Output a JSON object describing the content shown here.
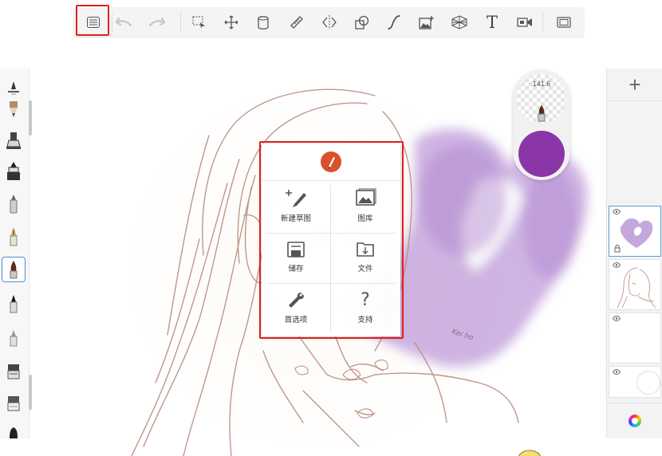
{
  "toolbar": {
    "buttons": [
      {
        "name": "menu-list-icon",
        "state": "highlighted"
      },
      {
        "name": "undo-icon",
        "state": "disabled"
      },
      {
        "name": "redo-icon",
        "state": "disabled"
      },
      {
        "name": "selection-icon"
      },
      {
        "name": "transform-icon"
      },
      {
        "name": "fill-icon"
      },
      {
        "name": "ruler-icon"
      },
      {
        "name": "symmetry-icon"
      },
      {
        "name": "shape-icon"
      },
      {
        "name": "stroke-curve-icon"
      },
      {
        "name": "add-image-icon"
      },
      {
        "name": "perspective-icon"
      },
      {
        "name": "text-icon",
        "glyph": "T"
      },
      {
        "name": "timelapse-icon"
      },
      {
        "name": "fullscreen-icon"
      }
    ]
  },
  "brushes": {
    "selected_index": 5,
    "items": [
      "brush-opacity-slider-icon",
      "pencil-brush-icon",
      "marker-brush-icon",
      "ink-pen-brush-icon",
      "ballpoint-brush-icon",
      "fountain-pen-brush-icon",
      "paint-brush-icon",
      "felt-tip-brush-icon",
      "airbrush-icon",
      "eraser-brush-icon",
      "soft-eraser-brush-icon",
      "smudge-brush-icon"
    ]
  },
  "puck": {
    "size_value": "141.6",
    "color": "#8a35a8"
  },
  "menu": {
    "items": [
      {
        "name": "new-sketch",
        "label": "新建草图",
        "icon": "new-sketch-icon"
      },
      {
        "name": "gallery",
        "label": "图库",
        "icon": "gallery-icon"
      },
      {
        "name": "save",
        "label": "储存",
        "icon": "save-icon"
      },
      {
        "name": "file",
        "label": "文件",
        "icon": "file-icon"
      },
      {
        "name": "preferences",
        "label": "首选项",
        "icon": "wrench-icon"
      },
      {
        "name": "support",
        "label": "支持",
        "icon": "question-icon",
        "glyph": "?"
      }
    ]
  },
  "layers": {
    "add_label": "+",
    "items": [
      {
        "name": "layer-watercolor",
        "active": true
      },
      {
        "name": "layer-sketch",
        "active": false
      },
      {
        "name": "layer-empty",
        "active": false
      },
      {
        "name": "layer-background",
        "active": false
      }
    ]
  },
  "canvas": {
    "signature": "Kei ho"
  },
  "colors": {
    "highlight": "#e02020",
    "line_art": "#b98c80",
    "watercolor": "#a77cc6",
    "selection": "#4a8fd8"
  }
}
